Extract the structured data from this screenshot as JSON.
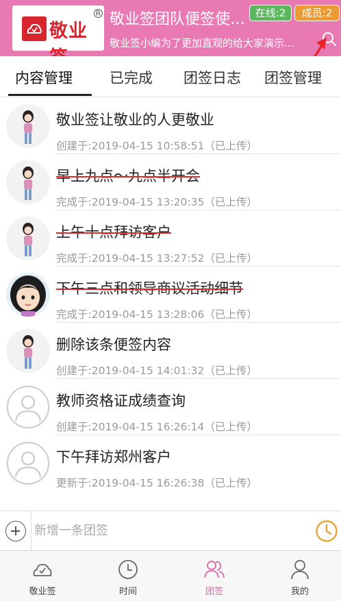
{
  "header": {
    "logo_text": "敬业签",
    "logo_reg": "R",
    "team_title": "敬业签团队便签使用教程",
    "team_subtitle": "敬业签小编为了更加直观的给大家演示团签功能",
    "online_badge": "在线:2",
    "members_badge": "成员:2",
    "brand_color": "#e979b3",
    "online_color": "#5cb85c",
    "members_color": "#eb9a34"
  },
  "tabs": [
    {
      "label": "内容管理",
      "active": true
    },
    {
      "label": "已完成",
      "active": false
    },
    {
      "label": "团签日志",
      "active": false
    },
    {
      "label": "团签管理",
      "active": false
    }
  ],
  "notes": [
    {
      "title": "敬业签让敬业的人更敬业",
      "meta": "创建于:2019-04-15 10:58:51（已上传）",
      "done": false,
      "avatar": "girl-avatar"
    },
    {
      "title": "早上九点～九点半开会",
      "meta": "完成于:2019-04-15 13:20:35（已上传）",
      "done": true,
      "avatar": "girl-avatar"
    },
    {
      "title": "上午十点拜访客户",
      "meta": "完成于:2019-04-15 13:27:52（已上传）",
      "done": true,
      "avatar": "girl-avatar"
    },
    {
      "title": "下午三点和领导商议活动细节",
      "meta": "完成于:2019-04-15 13:28:06（已上传）",
      "done": true,
      "avatar": "cartoon-avatar"
    },
    {
      "title": "删除该条便签内容",
      "meta": "创建于:2019-04-15 14:01:32（已上传）",
      "done": false,
      "avatar": "girl-avatar"
    },
    {
      "title": "教师资格证成绩查询",
      "meta": "创建于:2019-04-15 16:26:14（已上传）",
      "done": false,
      "avatar": "default-avatar"
    },
    {
      "title": "下午拜访郑州客户",
      "meta": "更新于:2019-04-15 16:26:38（已上传）",
      "done": false,
      "avatar": "default-avatar"
    }
  ],
  "input_bar": {
    "placeholder": "新增一条团签"
  },
  "bottom_nav": [
    {
      "label": "敬业签",
      "icon": "cloud-icon",
      "active": false
    },
    {
      "label": "时间",
      "icon": "clock-icon",
      "active": false
    },
    {
      "label": "团签",
      "icon": "team-icon",
      "active": true
    },
    {
      "label": "我的",
      "icon": "user-icon",
      "active": false
    }
  ],
  "accent_colors": {
    "strike": "#e0272d",
    "clock": "#e8a23a",
    "nav_active": "#e066a6"
  }
}
